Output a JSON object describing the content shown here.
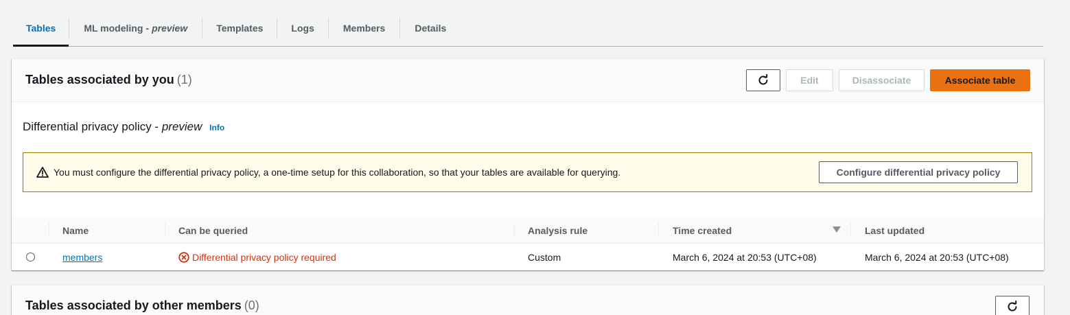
{
  "tabs": [
    {
      "label": "Tables"
    },
    {
      "label": "ML modeling",
      "dash": "-",
      "suffix": "preview"
    },
    {
      "label": "Templates"
    },
    {
      "label": "Logs"
    },
    {
      "label": "Members"
    },
    {
      "label": "Details"
    }
  ],
  "associated_by_you": {
    "title": "Tables associated by you",
    "count": "(1)",
    "buttons": {
      "refresh_icon": "refresh-icon",
      "edit": "Edit",
      "disassociate": "Disassociate",
      "associate": "Associate table"
    },
    "dp_policy": {
      "title": "Differential privacy policy - ",
      "title_suffix": "preview",
      "info": "Info"
    },
    "alert": {
      "icon": "warning-icon",
      "text": "You must configure the differential privacy policy, a one-time setup for this collaboration, so that your tables are available for querying.",
      "button": "Configure differential privacy policy"
    },
    "table": {
      "columns": [
        "Name",
        "Can be queried",
        "Analysis rule",
        "Time created",
        "Last updated"
      ],
      "sort_column": "Time created",
      "rows": [
        {
          "name": "members",
          "can_be_queried": "Differential privacy policy required",
          "analysis_rule": "Custom",
          "time_created": "March 6, 2024 at 20:53 (UTC+08)",
          "last_updated": "March 6, 2024 at 20:53 (UTC+08)"
        }
      ]
    }
  },
  "associated_by_others": {
    "title": "Tables associated by other members",
    "count": "(0)",
    "refresh_icon": "refresh-icon"
  },
  "colors": {
    "accent": "#0073bb",
    "primary_button": "#ec7211",
    "error": "#d13212",
    "warning_bg": "#fffce9",
    "warning_border": "#9e7a00"
  }
}
